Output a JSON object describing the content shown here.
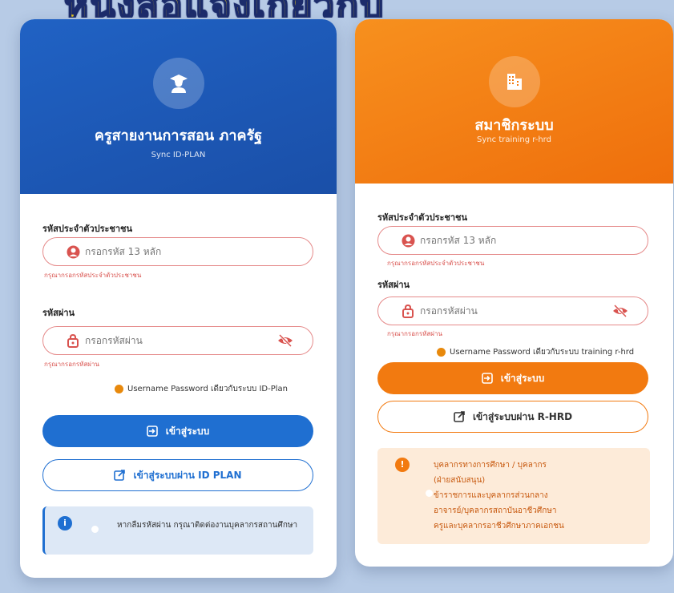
{
  "banner_text": "หนังสือแจ้งเกี่ยวกับ",
  "left": {
    "title": "ครูสายงานการสอน ภาครัฐ",
    "subtitle": "Sync ID-PLAN",
    "id_label": "รหัสประจำตัวประชาชน",
    "id_placeholder": "กรอกรหัส 13 หลัก",
    "id_error": "กรุณากรอกรหัสประจำตัวประชาชน",
    "pw_label": "รหัสผ่าน",
    "pw_placeholder": "กรอกรหัสผ่าน",
    "pw_error": "กรุณากรอกรหัสผ่าน",
    "note": "Username Password เดียวกับระบบ ID-Plan",
    "login_button": "เข้าสู่ระบบ",
    "alt_button": "เข้าสู่ระบบผ่าน ID PLAN",
    "info_icon": "i",
    "info_text": "หากลืมรหัสผ่าน กรุณาติดต่องานบุคลากรสถานศึกษา",
    "accent": "#1f6fd1",
    "icon": "graduate-user-icon"
  },
  "right": {
    "title": "สมาชิกระบบ",
    "subtitle": "Sync training r-hrd",
    "id_label": "รหัสประจำตัวประชาชน",
    "id_placeholder": "กรอกรหัส 13 หลัก",
    "id_error": "กรุณากรอกรหัสประจำตัวประชาชน",
    "pw_label": "รหัสผ่าน",
    "pw_placeholder": "กรอกรหัสผ่าน",
    "pw_error": "กรุณากรอกรหัสผ่าน",
    "note": "Username Password เดียวกับระบบ training r-hrd",
    "login_button": "เข้าสู่ระบบ",
    "alt_button": "เข้าสู่ระบบผ่าน R-HRD",
    "info_icon": "!",
    "info_lines": [
      "บุคลากรทางการศึกษา / บุคลากร",
      "(ฝ่ายสนับสนุน)",
      "ข้าราชการและบุคลากรส่วนกลาง",
      "อาจารย์/บุคลากรสถาบันอาชีวศึกษา",
      "ครูและบุคลากรอาชีวศึกษาภาคเอกชน"
    ],
    "accent": "#f27a10",
    "icon": "building-icon"
  }
}
